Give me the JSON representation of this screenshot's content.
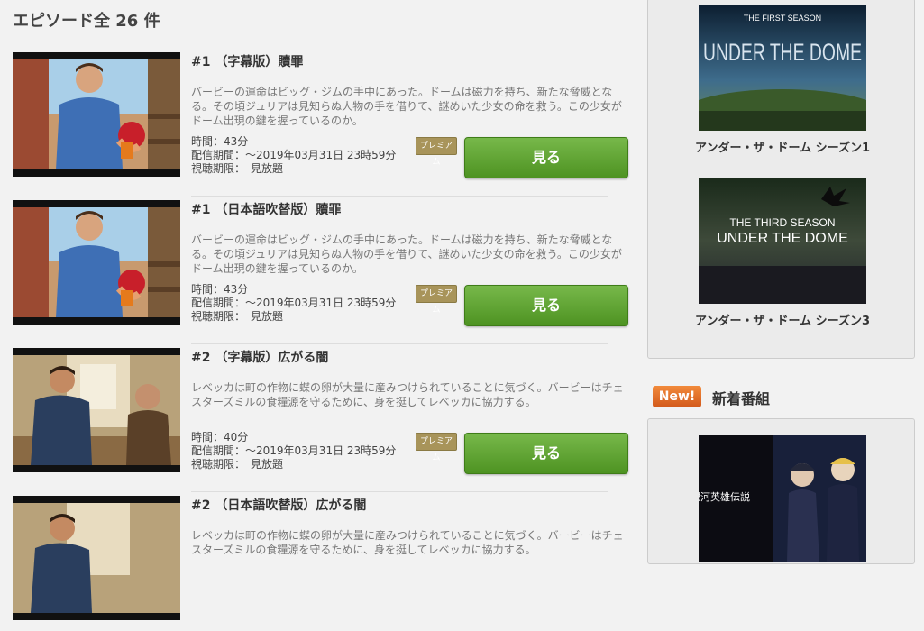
{
  "episode_list": {
    "count_heading": "エピソード全 26 件",
    "episodes": [
      {
        "title": "#1 （字幕版）贖罪",
        "description": "バービーの運命はビッグ・ジムの手中にあった。ドームは磁力を持ち、新たな脅威となる。その頃ジュリアは見知らぬ人物の手を借りて、謎めいた少女の命を救う。この少女がドーム出現の鍵を握っているのか。",
        "duration": "時間：43分",
        "availability": "配信期間：～2019年03月31日 23時59分",
        "viewing_period": "視聴期限：　見放題",
        "badge": "プレミアム",
        "button_label": "見る"
      },
      {
        "title": "#1 （日本語吹替版）贖罪",
        "description": "バービーの運命はビッグ・ジムの手中にあった。ドームは磁力を持ち、新たな脅威となる。その頃ジュリアは見知らぬ人物の手を借りて、謎めいた少女の命を救う。この少女がドーム出現の鍵を握っているのか。",
        "duration": "時間：43分",
        "availability": "配信期間：～2019年03月31日 23時59分",
        "viewing_period": "視聴期限：　見放題",
        "badge": "プレミアム",
        "button_label": "見る"
      },
      {
        "title": "#2 （字幕版）広がる闇",
        "description": "レベッカは町の作物に蝶の卵が大量に産みつけられていることに気づく。バービーはチェスターズミルの食糧源を守るために、身を挺してレベッカに協力する。",
        "duration": "時間：40分",
        "availability": "配信期間：～2019年03月31日 23時59分",
        "viewing_period": "視聴期限：　見放題",
        "badge": "プレミアム",
        "button_label": "見る"
      },
      {
        "title": "#2 （日本語吹替版）広がる闇",
        "description": "レベッカは町の作物に蝶の卵が大量に産みつけられていることに気づく。バービーはチェスターズミルの食糧源を守るために、身を挺してレベッカに協力する。",
        "duration": "",
        "availability": "",
        "viewing_period": "",
        "badge": "",
        "button_label": ""
      }
    ]
  },
  "related_series": [
    {
      "poster_text_top": "THE FIRST SEASON",
      "poster_text_main": "UNDER THE DOME",
      "title": "アンダー・ザ・ドーム シーズン1"
    },
    {
      "poster_text_top": "THE THIRD SEASON",
      "poster_text_main": "UNDER THE DOME",
      "title": "アンダー・ザ・ドーム シーズン3"
    }
  ],
  "new_programs": {
    "badge": "New!",
    "heading": "新着番組",
    "poster_text": "銀河英雄伝説"
  },
  "colors": {
    "watch_button": "#5ea32f",
    "premium_badge": "#a8945a",
    "new_badge": "#e4722c"
  }
}
